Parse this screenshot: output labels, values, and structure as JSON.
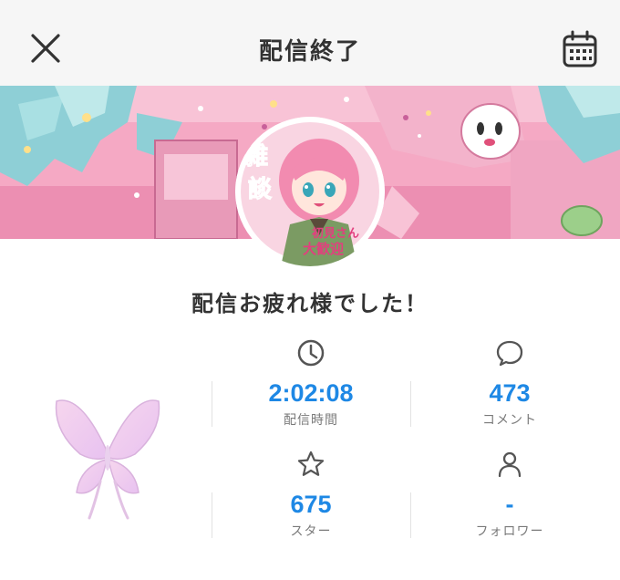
{
  "header": {
    "title": "配信終了",
    "close_icon": "close-icon",
    "calendar_icon": "calendar-icon"
  },
  "message": "配信お疲れ様でした！",
  "avatar_text": {
    "line1": "雑",
    "line2": "談",
    "line3": "初見さん",
    "line4": "大歓迎"
  },
  "stats": [
    {
      "icon": "clock-icon",
      "value": "2:02:08",
      "label": "配信時間"
    },
    {
      "icon": "comment-icon",
      "value": "473",
      "label": "コメント"
    },
    {
      "icon": "star-icon",
      "value": "675",
      "label": "スター"
    },
    {
      "icon": "person-icon",
      "value": "-",
      "label": "フォロワー"
    }
  ],
  "colors": {
    "accent": "#1e88e5",
    "header_bg": "#f6f6f6",
    "text": "#333333",
    "label": "#7a7a7a"
  }
}
